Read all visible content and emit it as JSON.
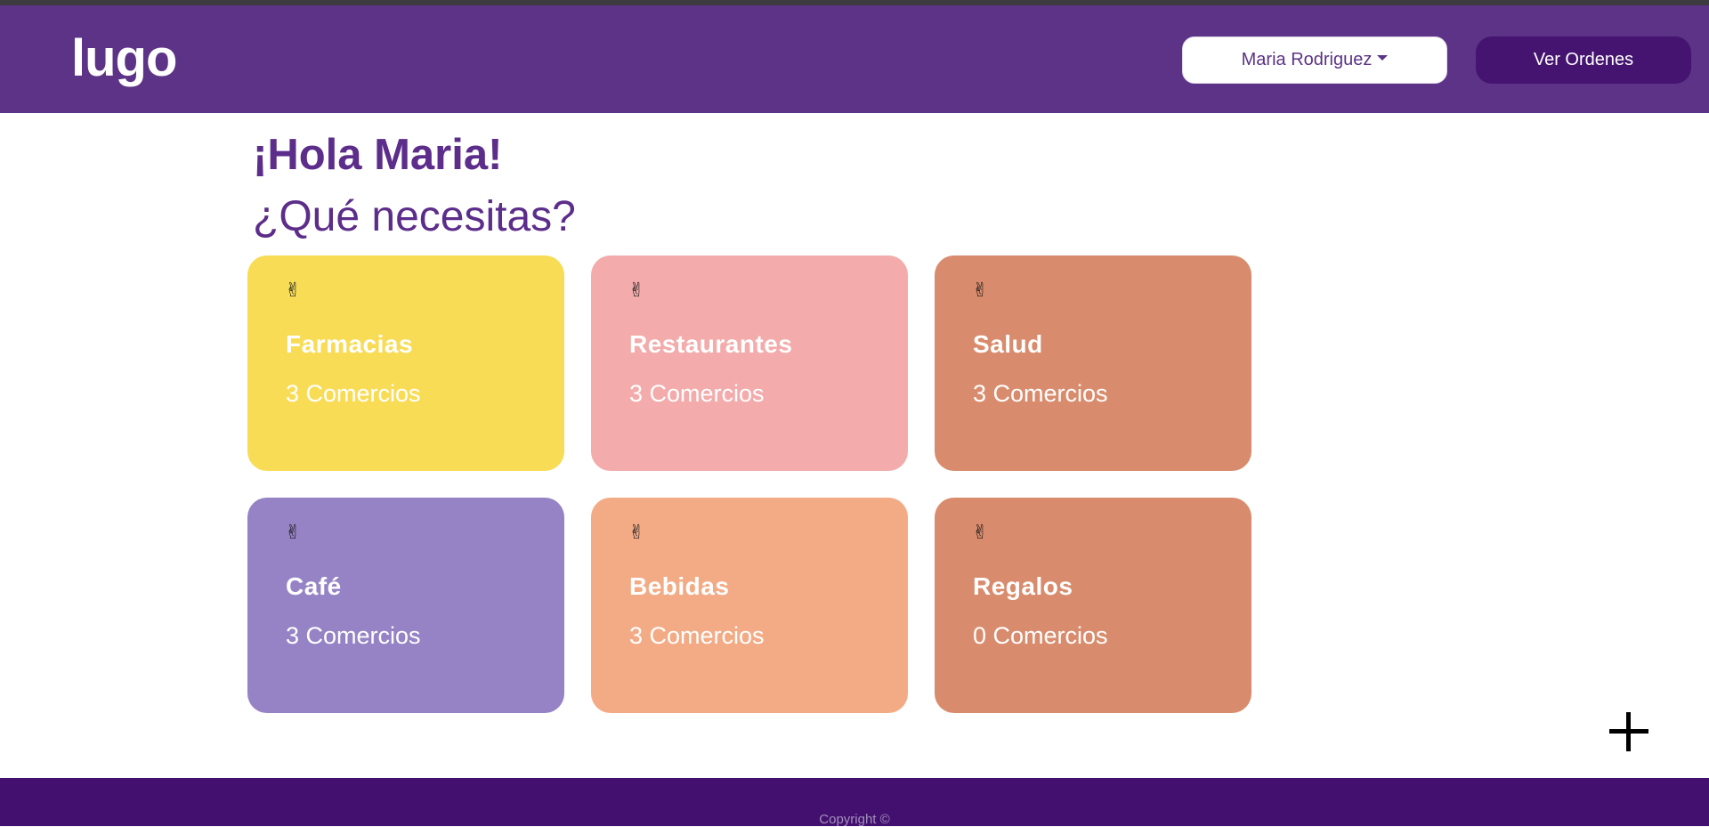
{
  "header": {
    "logo": "lugo",
    "user_menu_label": "Maria Rodriguez",
    "orders_button_label": "Ver Ordenes"
  },
  "main": {
    "greeting": "¡Hola Maria!",
    "question": "¿Qué necesitas?",
    "categories": [
      {
        "name": "Farmacias",
        "count": "3 Comercios",
        "icon": "✌",
        "color": "#f8dc56"
      },
      {
        "name": "Restaurantes",
        "count": "3 Comercios",
        "icon": "✌",
        "color": "#f3abab"
      },
      {
        "name": "Salud",
        "count": "3 Comercios",
        "icon": "✌",
        "color": "#d98c6d"
      },
      {
        "name": "Café",
        "count": "3 Comercios",
        "icon": "✌",
        "color": "#9583c5"
      },
      {
        "name": "Bebidas",
        "count": "3 Comercios",
        "icon": "✌",
        "color": "#f3ab86"
      },
      {
        "name": "Regalos",
        "count": "0 Comercios",
        "icon": "✌",
        "color": "#d98c6d"
      }
    ]
  },
  "fab": {
    "icon": "plus-icon"
  },
  "footer": {
    "copyright": "Copyright ©"
  }
}
